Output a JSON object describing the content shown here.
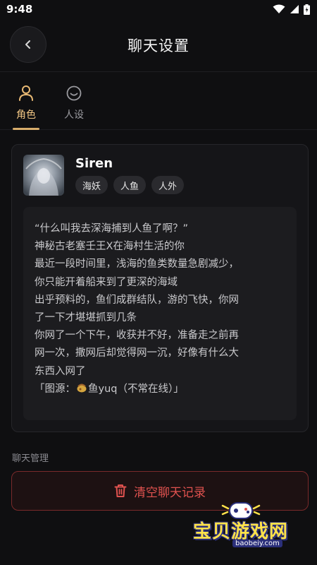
{
  "status_bar": {
    "time": "9:48"
  },
  "header": {
    "title": "聊天设置"
  },
  "tabs": [
    {
      "label": "角色",
      "active": true,
      "icon": "person-icon"
    },
    {
      "label": "人设",
      "active": false,
      "icon": "smile-icon"
    }
  ],
  "character": {
    "name": "Siren",
    "tags": [
      "海妖",
      "人鱼",
      "人外"
    ],
    "description_lines": [
      "“什么叫我去深海捕到人鱼了啊？”",
      "神秘古老塞壬王X在海村生活的你",
      "最近一段时间里，浅海的鱼类数量急剧减少，",
      "你只能开着船来到了更深的海域",
      "出乎预料的，鱼们成群结队，游的飞快，你网",
      "了一下才堪堪抓到几条",
      "你网了一个下午，收获并不好，准备走之前再",
      "网一次，撒网后却觉得网一沉，好像有什么大",
      "东西入网了"
    ],
    "source_prefix": "「图源：",
    "source_suffix": "鱼yuq（不常在线）」"
  },
  "chat_management": {
    "section_label": "聊天管理",
    "clear_button_label": "清空聊天记录"
  },
  "watermark": {
    "text": "宝贝游戏网",
    "url": "baobeiy.com"
  },
  "colors": {
    "background": "#0f0f11",
    "accent_gold": "#f1c684",
    "danger_red": "#e0524f",
    "watermark_yellow": "#ffe24a"
  }
}
